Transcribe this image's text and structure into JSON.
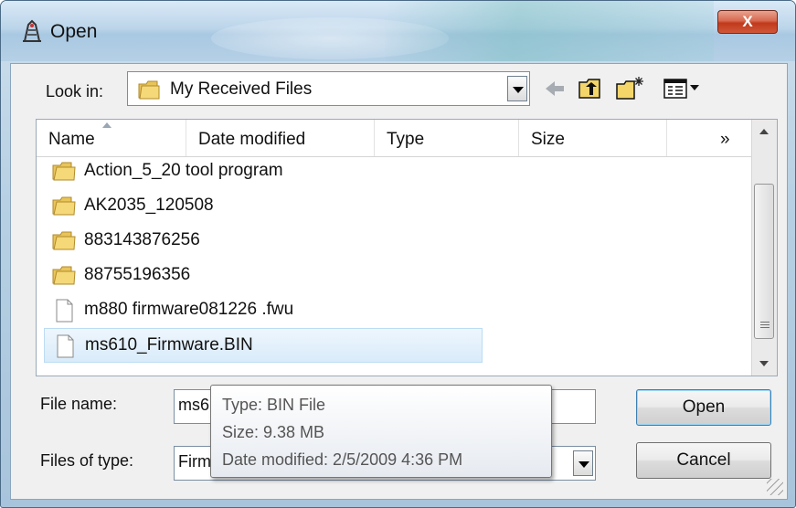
{
  "window": {
    "title": "Open",
    "close_label": "X"
  },
  "lookin": {
    "label": "Look in:",
    "value": "My Received Files"
  },
  "toolbar": {
    "icons": [
      "back-icon",
      "up-folder-icon",
      "new-folder-icon",
      "view-menu-icon"
    ]
  },
  "columns": [
    {
      "label": "Name"
    },
    {
      "label": "Date modified"
    },
    {
      "label": "Type"
    },
    {
      "label": "Size"
    },
    {
      "label": "»"
    }
  ],
  "files": [
    {
      "name": "Action_5_20 tool program",
      "kind": "folder"
    },
    {
      "name": "AK2035_120508",
      "kind": "folder"
    },
    {
      "name": "883143876256",
      "kind": "folder"
    },
    {
      "name": "88755196356",
      "kind": "folder"
    },
    {
      "name": "m880 firmware081226 .fwu",
      "kind": "file"
    },
    {
      "name": "ms610_Firmware.BIN",
      "kind": "file",
      "selected": true
    }
  ],
  "filename": {
    "label": "File name:",
    "value": "ms6"
  },
  "filetype": {
    "label": "Files of type:",
    "value": "Firm"
  },
  "buttons": {
    "open": "Open",
    "cancel": "Cancel"
  },
  "tooltip": {
    "type": "Type: BIN File",
    "size": "Size: 9.38 MB",
    "date": "Date modified: 2/5/2009 4:36 PM"
  }
}
